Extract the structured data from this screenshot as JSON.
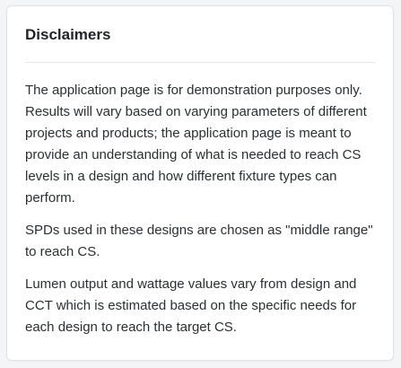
{
  "card": {
    "title": "Disclaimers",
    "paragraphs": [
      "The application page is for demonstration purposes only. Results will vary based on varying parameters of different projects and products; the application page is meant to provide an understanding of what is needed to reach CS levels in a design and how different fixture types can perform.",
      "SPDs used in these designs are chosen as \"middle range\" to reach CS.",
      "Lumen output and wattage values vary from design and CCT which is estimated based on the specific needs for each design to reach the target CS."
    ]
  }
}
